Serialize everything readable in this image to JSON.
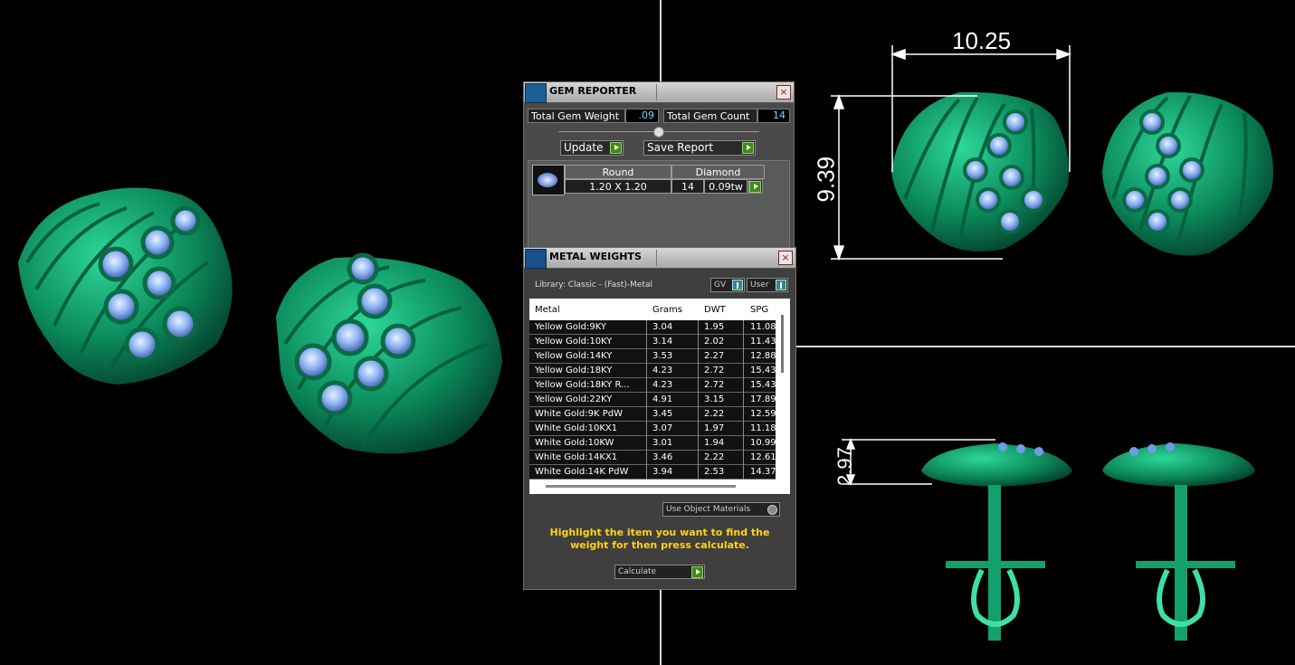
{
  "viewport": {
    "dimensions": {
      "width": "10.25",
      "height": "9.39",
      "depth": "2.97"
    }
  },
  "gem_reporter": {
    "title": "GEM REPORTER",
    "close": "×",
    "total_weight_label": "Total Gem Weight",
    "total_weight_value": ".09",
    "total_count_label": "Total Gem Count",
    "total_count_value": "14",
    "update_label": "Update",
    "save_label": "Save Report",
    "gem": {
      "shape": "Round",
      "type": "Diamond",
      "size": "1.20 X 1.20",
      "count": "14",
      "weight": "0.09tw"
    }
  },
  "metal_weights": {
    "title": "METAL WEIGHTS",
    "close": "×",
    "library": "Library: Classic - (Fast)-Metal",
    "gv_label": "GV",
    "user_label": "User",
    "columns": [
      "Metal",
      "Grams",
      "DWT",
      "SPG"
    ],
    "rows": [
      [
        "Yellow Gold:9KY",
        "3.04",
        "1.95",
        "11.08"
      ],
      [
        "Yellow Gold:10KY",
        "3.14",
        "2.02",
        "11.43"
      ],
      [
        "Yellow Gold:14KY",
        "3.53",
        "2.27",
        "12.88"
      ],
      [
        "Yellow Gold:18KY",
        "4.23",
        "2.72",
        "15.43"
      ],
      [
        "Yellow Gold:18KY R...",
        "4.23",
        "2.72",
        "15.43"
      ],
      [
        "Yellow Gold:22KY",
        "4.91",
        "3.15",
        "17.89"
      ],
      [
        "White Gold:9K PdW",
        "3.45",
        "2.22",
        "12.59"
      ],
      [
        "White Gold:10KX1",
        "3.07",
        "1.97",
        "11.18"
      ],
      [
        "White Gold:10KW",
        "3.01",
        "1.94",
        "10.99"
      ],
      [
        "White Gold:14KX1",
        "3.46",
        "2.22",
        "12.61"
      ],
      [
        "White Gold:14K PdW",
        "3.94",
        "2.53",
        "14.37"
      ]
    ],
    "use_object_materials": "Use Object Materials",
    "hint": "Highlight the item you want to find the weight for then press calculate.",
    "calculate_label": "Calculate"
  },
  "colors": {
    "metal": "#0d8a5c",
    "gem": "#5a86d8",
    "hint": "#ffd21a",
    "value_text": "#7fd3ff"
  }
}
